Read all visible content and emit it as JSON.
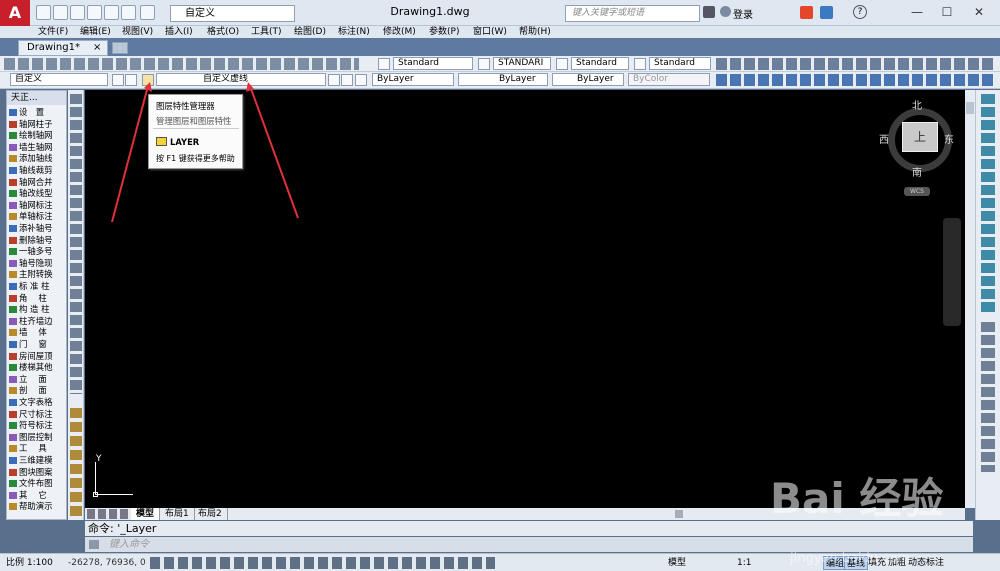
{
  "title_bar": {
    "app_logo": "A",
    "workspace": "自定义",
    "document_title": "Drawing1.dwg",
    "search_placeholder": "键入关键字或短语",
    "login_label": "登录",
    "help_label": "?",
    "minimize": "—",
    "maximize": "☐",
    "close": "✕"
  },
  "menu": [
    "文件(F)",
    "编辑(E)",
    "视图(V)",
    "插入(I)",
    "格式(O)",
    "工具(T)",
    "绘图(D)",
    "标注(N)",
    "修改(M)",
    "参数(P)",
    "窗口(W)",
    "帮助(H)"
  ],
  "tabs": {
    "document_tab": "Drawing1*",
    "close": "×"
  },
  "toolbar1": {
    "text_style": "Standard",
    "dim_style": "STANDARI",
    "table_style": "Standard",
    "mleader_style": "Standard"
  },
  "toolbar2": {
    "workspace_select": "自定义",
    "layer_select": "自定义虚线",
    "color_select": "ByLayer",
    "linetype_select": "ByLayer",
    "lineweight_select": "ByLayer",
    "plotstyle_select": "ByColor"
  },
  "left_panel": {
    "title": "天正...",
    "items": [
      "设　置",
      "轴网柱子",
      "绘制轴网",
      "墙生轴网",
      "添加轴线",
      "轴线裁剪",
      "轴网合并",
      "轴改线型",
      "轴网标注",
      "单轴标注",
      "添补轴号",
      "删除轴号",
      "一轴多号",
      "轴号隐现",
      "主附转换",
      "标 准 柱",
      "角　 柱",
      "构 造 柱",
      "柱齐墙边",
      "墙　 体",
      "门　 窗",
      "房间屋顶",
      "楼梯其他",
      "立　 面",
      "剖　 面",
      "文字表格",
      "尺寸标注",
      "符号标注",
      "图层控制",
      "工　 具",
      "三维建模",
      "图块图案",
      "文件布图",
      "其　 它",
      "帮助演示"
    ]
  },
  "tooltip": {
    "title": "图层特性管理器",
    "description": "管理图层和图层特性",
    "command": "LAYER",
    "help": "按 F1 键获得更多帮助"
  },
  "viewcube": {
    "north": "北",
    "south": "南",
    "east": "东",
    "west": "西",
    "face": "上",
    "wcs": "WCS"
  },
  "ucs": {
    "y_label": "Y"
  },
  "layout_tabs": [
    "模型",
    "布局1",
    "布局2"
  ],
  "command_line": {
    "history": "命令: '_Layer",
    "input_placeholder": "键入命令"
  },
  "status_bar": {
    "scale": "比例 1:100",
    "coordinates": "-26278, 76936, 0",
    "model_label": "模型",
    "annotation_scale": "1:1",
    "buttons": [
      "编组",
      "基线",
      "填充",
      "加粗",
      "动态标注"
    ]
  },
  "watermark": {
    "logo": "Bai 经验",
    "url": "jingyan.baidu.com"
  },
  "colors": {
    "canvas": "#000000",
    "app_red": "#c8202a",
    "annotation_arrow": "#e0303a"
  }
}
